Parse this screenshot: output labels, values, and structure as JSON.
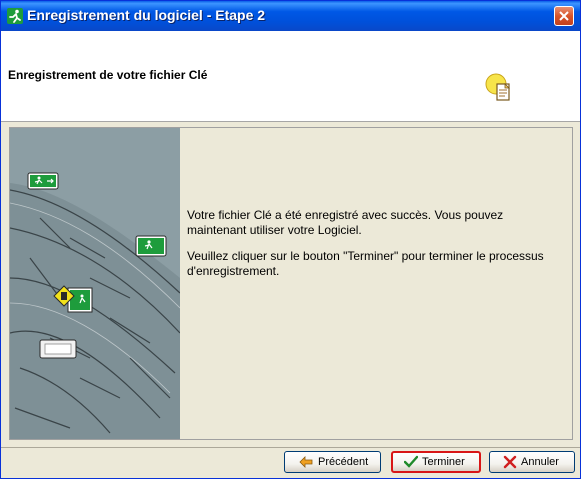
{
  "window": {
    "title": "Enregistrement du logiciel - Etape 2",
    "close_icon": "close-icon",
    "title_icon": "running-man-icon"
  },
  "header": {
    "title": "Enregistrement de votre fichier Clé",
    "icon": "key-document-icon"
  },
  "content": {
    "side_image": "building-plan-illustration",
    "message_line1": "Votre fichier Clé a été enregistré avec succès. Vous pouvez maintenant utiliser votre Logiciel.",
    "message_line2": " Veuillez cliquer sur le bouton \"Terminer\" pour terminer le processus d'enregistrement."
  },
  "buttons": {
    "previous": {
      "label": "Précédent",
      "icon": "arrow-left-icon"
    },
    "finish": {
      "label": "Terminer",
      "icon": "checkmark-icon",
      "highlight_color": "#d81616"
    },
    "cancel": {
      "label": "Annuler",
      "icon": "x-icon"
    }
  },
  "colors": {
    "titlebar": "#0058e6",
    "dialog_bg": "#ece9d8",
    "image_bg": "#8a9ca2"
  }
}
